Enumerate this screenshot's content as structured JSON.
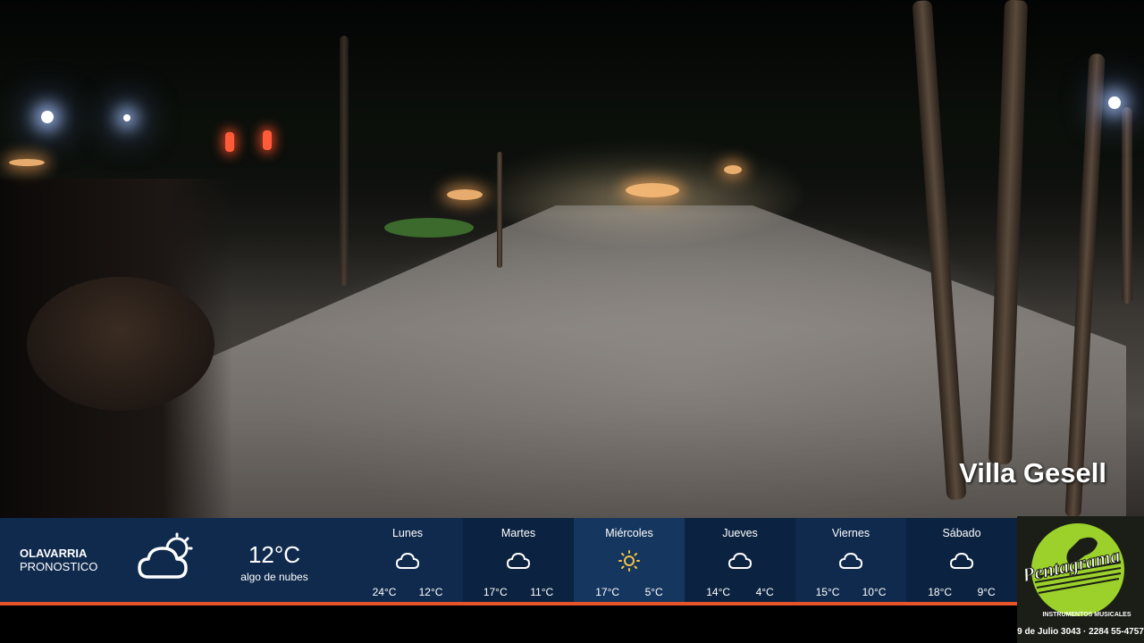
{
  "overlay": {
    "location": "Villa Gesell"
  },
  "weather": {
    "city": "OLAVARRIA",
    "label": "PRONOSTICO",
    "current": {
      "icon": "cloud-icon",
      "temp": "12°C",
      "description": "algo de nubes"
    },
    "forecast": [
      {
        "day": "Lunes",
        "icon": "cloud-icon",
        "high": "24°C",
        "low": "12°C"
      },
      {
        "day": "Martes",
        "icon": "cloud-icon",
        "high": "17°C",
        "low": "11°C"
      },
      {
        "day": "Miércoles",
        "icon": "sun-icon",
        "high": "17°C",
        "low": "5°C"
      },
      {
        "day": "Jueves",
        "icon": "cloud-icon",
        "high": "14°C",
        "low": "4°C"
      },
      {
        "day": "Viernes",
        "icon": "cloud-icon",
        "high": "15°C",
        "low": "10°C"
      },
      {
        "day": "Sábado",
        "icon": "cloud-icon",
        "high": "18°C",
        "low": "9°C"
      }
    ],
    "colors": {
      "bar": "#0f2a4d",
      "accent": "#e8542a"
    }
  },
  "sponsor": {
    "name": "Pentagrama",
    "tagline": "INSTRUMENTOS MUSICALES",
    "contact": "9 de Julio 3043 · 2284 55-4757",
    "colors": {
      "logo": "#9bd12a"
    }
  }
}
